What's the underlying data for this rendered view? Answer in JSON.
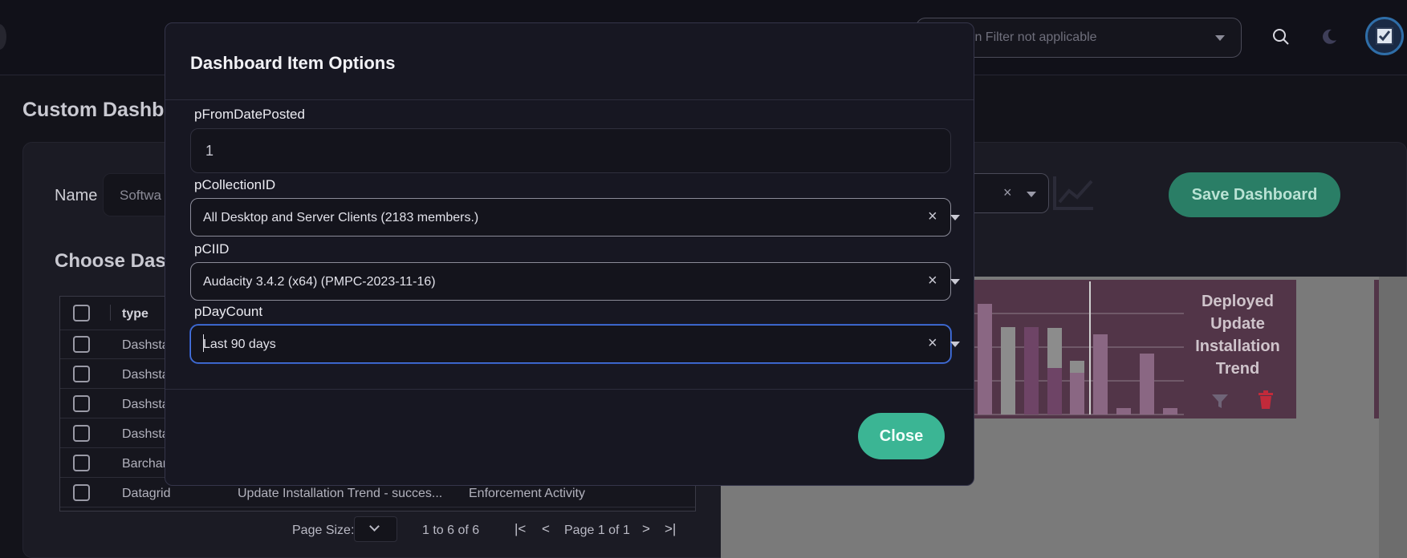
{
  "header": {
    "collection_filter_text": "ion Filter not applicable"
  },
  "page": {
    "title": "Custom Dashb",
    "name_label": "Name",
    "name_value": "Softwa",
    "save_label": "Save Dashboard",
    "choose_title": "Choose Das"
  },
  "grid": {
    "header_type": "type",
    "rows": [
      {
        "type": "Dashsta",
        "name": "",
        "category": ""
      },
      {
        "type": "Dashsta",
        "name": "",
        "category": ""
      },
      {
        "type": "Dashsta",
        "name": "",
        "category": ""
      },
      {
        "type": "Dashsta",
        "name": "",
        "category": ""
      },
      {
        "type": "Barchar",
        "name": "",
        "category": ""
      },
      {
        "type": "Datagrid",
        "name": "Update Installation Trend - succes...",
        "category": "Enforcement Activity"
      }
    ],
    "pager": {
      "page_size_label": "Page Size:",
      "count_text": "1 to 6 of 6",
      "page_text": "Page 1 of 1"
    }
  },
  "preview": {
    "card_title": "Deployed Update Installation Trend"
  },
  "modal": {
    "title": "Dashboard Item Options",
    "fields": [
      {
        "label": "pFromDatePosted",
        "value": "1"
      },
      {
        "label": "pCollectionID",
        "value": "All Desktop and Server Clients (2183 members.)"
      },
      {
        "label": "pCIID",
        "value": "Audacity 3.4.2 (x64) (PMPC-2023-11-16)"
      },
      {
        "label": "pDayCount",
        "value": "Last 90 days"
      }
    ],
    "close_label": "Close"
  },
  "icons": {
    "clear": "×",
    "first_page": "|<",
    "prev_page": "<",
    "next_page": ">",
    "last_page": ">|"
  },
  "colors": {
    "accent": "#3bb594",
    "focus": "#4a78e6",
    "card": "#523548"
  }
}
